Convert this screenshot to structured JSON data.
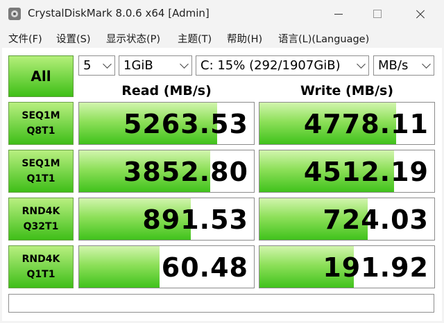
{
  "window": {
    "title": "CrystalDiskMark 8.0.6 x64 [Admin]"
  },
  "menu": {
    "items": [
      "文件(F)",
      "设置(S)",
      "显示状态(P)",
      "主题(T)",
      "帮助(H)",
      "语言(L)(Language)"
    ]
  },
  "controls": {
    "all_label": "All",
    "count": "5",
    "size": "1GiB",
    "drive": "C: 15% (292/1907GiB)",
    "unit": "MB/s"
  },
  "headers": {
    "read": "Read (MB/s)",
    "write": "Write (MB/s)"
  },
  "rows": [
    {
      "line1": "SEQ1M",
      "line2": "Q8T1",
      "read": "5263.53",
      "write": "4778.11",
      "read_fill": 0.79,
      "write_fill": 0.78
    },
    {
      "line1": "SEQ1M",
      "line2": "Q1T1",
      "read": "3852.80",
      "write": "4512.19",
      "read_fill": 0.75,
      "write_fill": 0.77
    },
    {
      "line1": "RND4K",
      "line2": "Q32T1",
      "read": "891.53",
      "write": "724.03",
      "read_fill": 0.64,
      "write_fill": 0.62
    },
    {
      "line1": "RND4K",
      "line2": "Q1T1",
      "read": "60.48",
      "write": "191.92",
      "read_fill": 0.46,
      "write_fill": 0.54
    }
  ],
  "status_text": "",
  "colors": {
    "accent_green": "#40c21c",
    "light_green": "#d2f5ae"
  }
}
